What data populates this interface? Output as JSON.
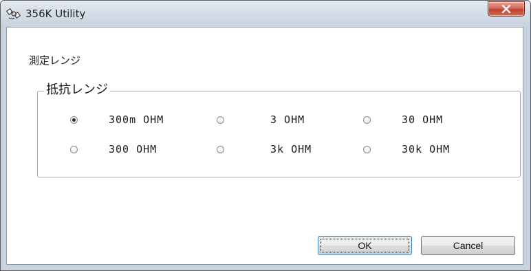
{
  "window": {
    "title": "356K Utility",
    "app_icon": "satellite-icon",
    "close_glyph": "x"
  },
  "section": {
    "title": "測定レンジ"
  },
  "group": {
    "label": "抵抗レンジ",
    "options": [
      {
        "label": "300m OHM",
        "selected": true
      },
      {
        "label": "3 OHM",
        "selected": false
      },
      {
        "label": "30 OHM",
        "selected": false
      },
      {
        "label": "300 OHM",
        "selected": false
      },
      {
        "label": "3k OHM",
        "selected": false
      },
      {
        "label": "30k OHM",
        "selected": false
      }
    ]
  },
  "buttons": {
    "ok": "OK",
    "cancel": "Cancel"
  }
}
